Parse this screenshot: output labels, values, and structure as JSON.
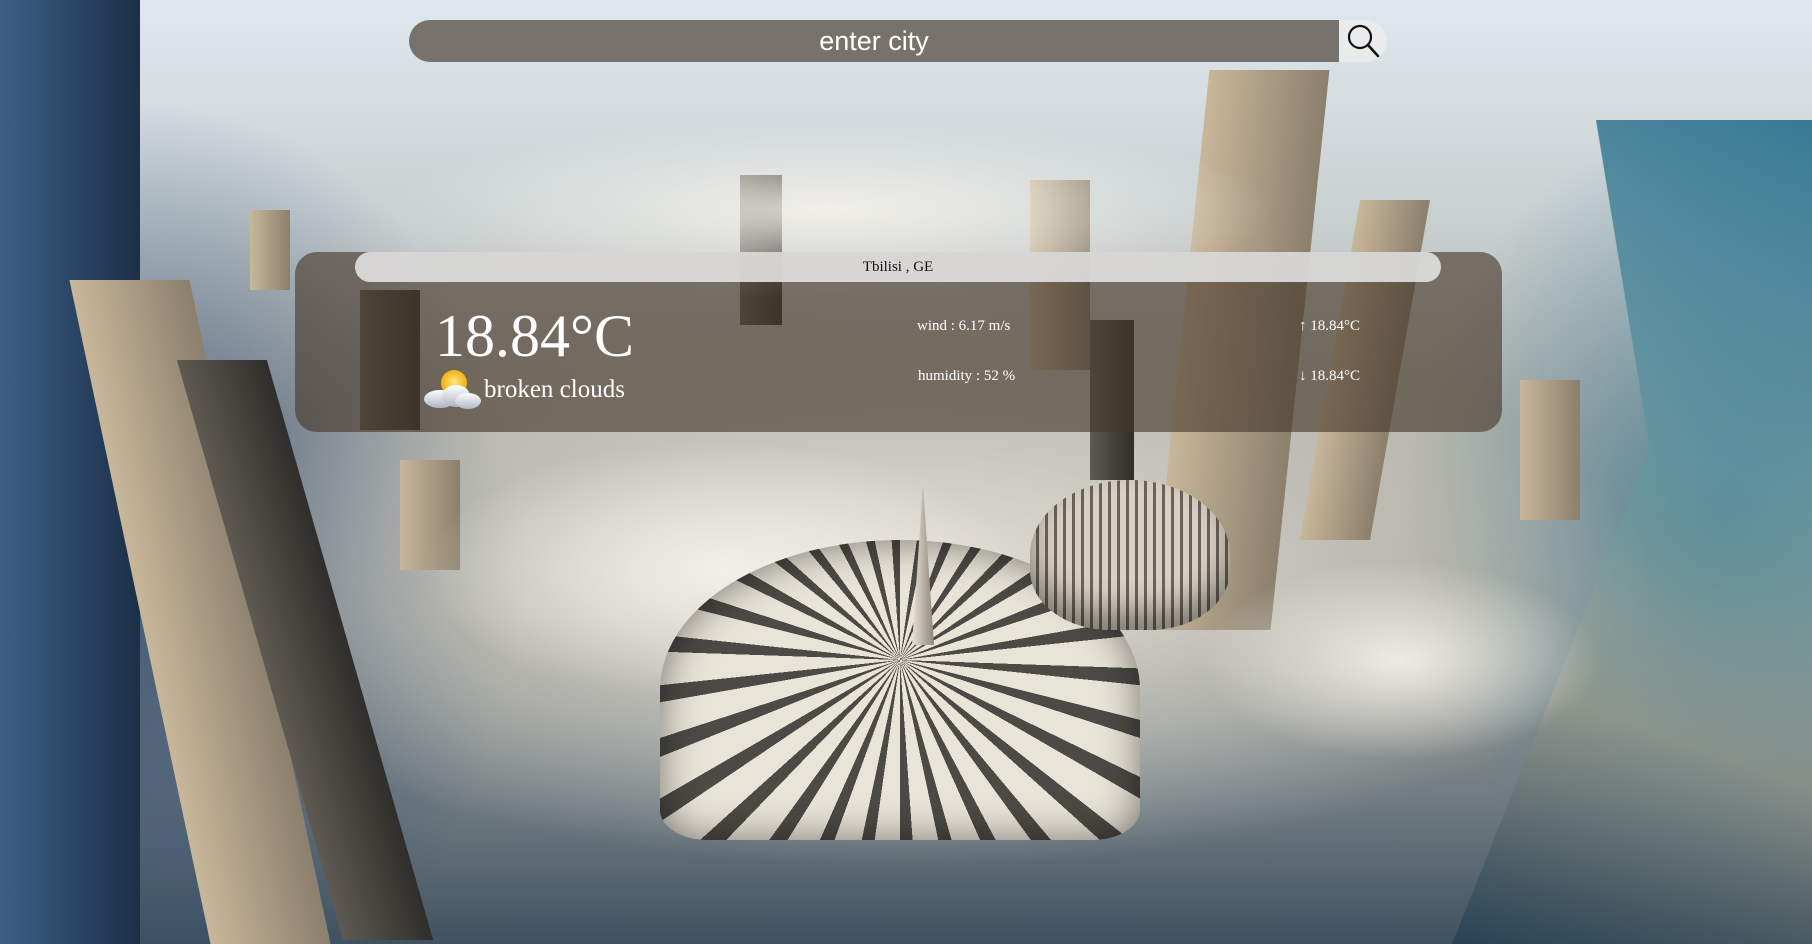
{
  "search": {
    "placeholder": "enter city",
    "icon": "search-icon"
  },
  "weather": {
    "location": "Tbilisi , GE",
    "temperature": "18.84°C",
    "condition": "broken clouds",
    "condition_icon": "partly-cloudy-icon",
    "wind": "wind : 6.17 m/s",
    "humidity": "humidity : 52 %",
    "temp_max": "↑ 18.84°C",
    "temp_min": "↓ 18.84°C"
  },
  "background": {
    "scene": "aerial-city-icon"
  }
}
